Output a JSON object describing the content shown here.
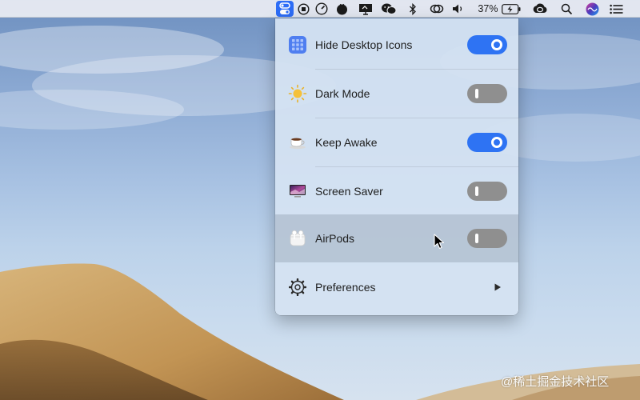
{
  "menubar": {
    "battery_percent": "37%",
    "icons": [
      "control-switch-icon",
      "record-icon",
      "gauge-icon",
      "tomato-icon",
      "display-icon",
      "wechat-icon",
      "bluetooth-icon",
      "link-icon",
      "volume-icon",
      "battery-icon",
      "creative-cloud-icon",
      "search-icon",
      "siri-icon",
      "list-icon"
    ]
  },
  "panel": {
    "items": [
      {
        "label": "Hide Desktop Icons",
        "icon": "grid-icon",
        "toggle": "on"
      },
      {
        "label": "Dark Mode",
        "icon": "sun-icon",
        "toggle": "off"
      },
      {
        "label": "Keep Awake",
        "icon": "coffee-cup-icon",
        "toggle": "on"
      },
      {
        "label": "Screen Saver",
        "icon": "screen-saver-icon",
        "toggle": "off"
      },
      {
        "label": "AirPods",
        "icon": "airpods-icon",
        "toggle": "off",
        "hovered": true
      },
      {
        "label": "Preferences",
        "icon": "gear-icon",
        "submenu": true
      }
    ]
  },
  "colors": {
    "accent": "#2e73f3",
    "toggle_off": "#8f8f8f"
  },
  "watermark": "@稀土掘金技术社区"
}
